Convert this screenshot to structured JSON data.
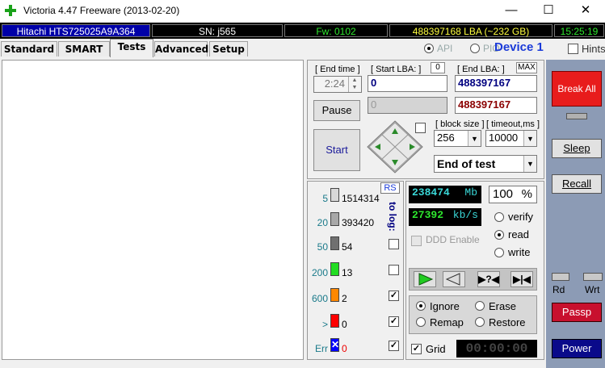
{
  "window": {
    "title": "Victoria 4.47  Freeware (2013-02-20)",
    "minimize": "—",
    "maximize": "☐",
    "close": "✕"
  },
  "info": {
    "model": "Hitachi HTS725025A9A364",
    "sn": "SN: j565",
    "fw": "Fw: 0102",
    "lba": "488397168 LBA (~232 GB)",
    "time": "15:25:19"
  },
  "tabs": [
    {
      "label": "Standard"
    },
    {
      "label": "SMART"
    },
    {
      "label": "Tests"
    },
    {
      "label": "Advanced"
    },
    {
      "label": "Setup"
    }
  ],
  "mode": {
    "api": "API",
    "pio": "PIO",
    "device": "Device 1",
    "hints": "Hints"
  },
  "controls": {
    "end_time_label": "[ End time ]",
    "end_time": "2:24",
    "start_lba_label": "[ Start LBA: ]",
    "start_lba_zero": "0",
    "start_lba": "0",
    "end_lba_label": "[ End LBA: ]",
    "end_lba_max": "MAX",
    "end_lba": "488397167",
    "end_lba_current": "488397167",
    "pause": "Pause",
    "start": "Start",
    "block_size_label": "[ block size ]",
    "block_size": "256",
    "timeout_label": "[ timeout,ms ]",
    "timeout": "10000",
    "end_action": "End of test"
  },
  "stats": {
    "rs": "RS",
    "to_log": "to log:",
    "rows": [
      {
        "label": "5",
        "value": "1514314",
        "color": "#d8d8d8"
      },
      {
        "label": "20",
        "value": "393420",
        "color": "#a8a8a8"
      },
      {
        "label": "50",
        "value": "54",
        "color": "#707070"
      },
      {
        "label": "200",
        "value": "13",
        "color": "#22dd22"
      },
      {
        "label": "600",
        "value": "2",
        "color": "#ff8800"
      },
      {
        "label": ">",
        "value": "0",
        "color": "#ff0000"
      },
      {
        "label": "Err",
        "value": "0",
        "color": "#0000ff"
      }
    ]
  },
  "test": {
    "mb_value": "238474",
    "mb_unit": "Mb",
    "percent": "100",
    "percent_unit": "%",
    "speed": "27392",
    "speed_unit": "kb/s",
    "ddd": "DDD Enable",
    "verify": "verify",
    "read": "read",
    "write": "write",
    "ignore": "Ignore",
    "erase": "Erase",
    "remap": "Remap",
    "restore": "Restore",
    "grid": "Grid",
    "timer": "00:00:00"
  },
  "side": {
    "break_all": "Break All",
    "sleep": "Sleep",
    "recall": "Recall",
    "rd": "Rd",
    "wrt": "Wrt",
    "passp": "Passp",
    "power": "Power"
  }
}
